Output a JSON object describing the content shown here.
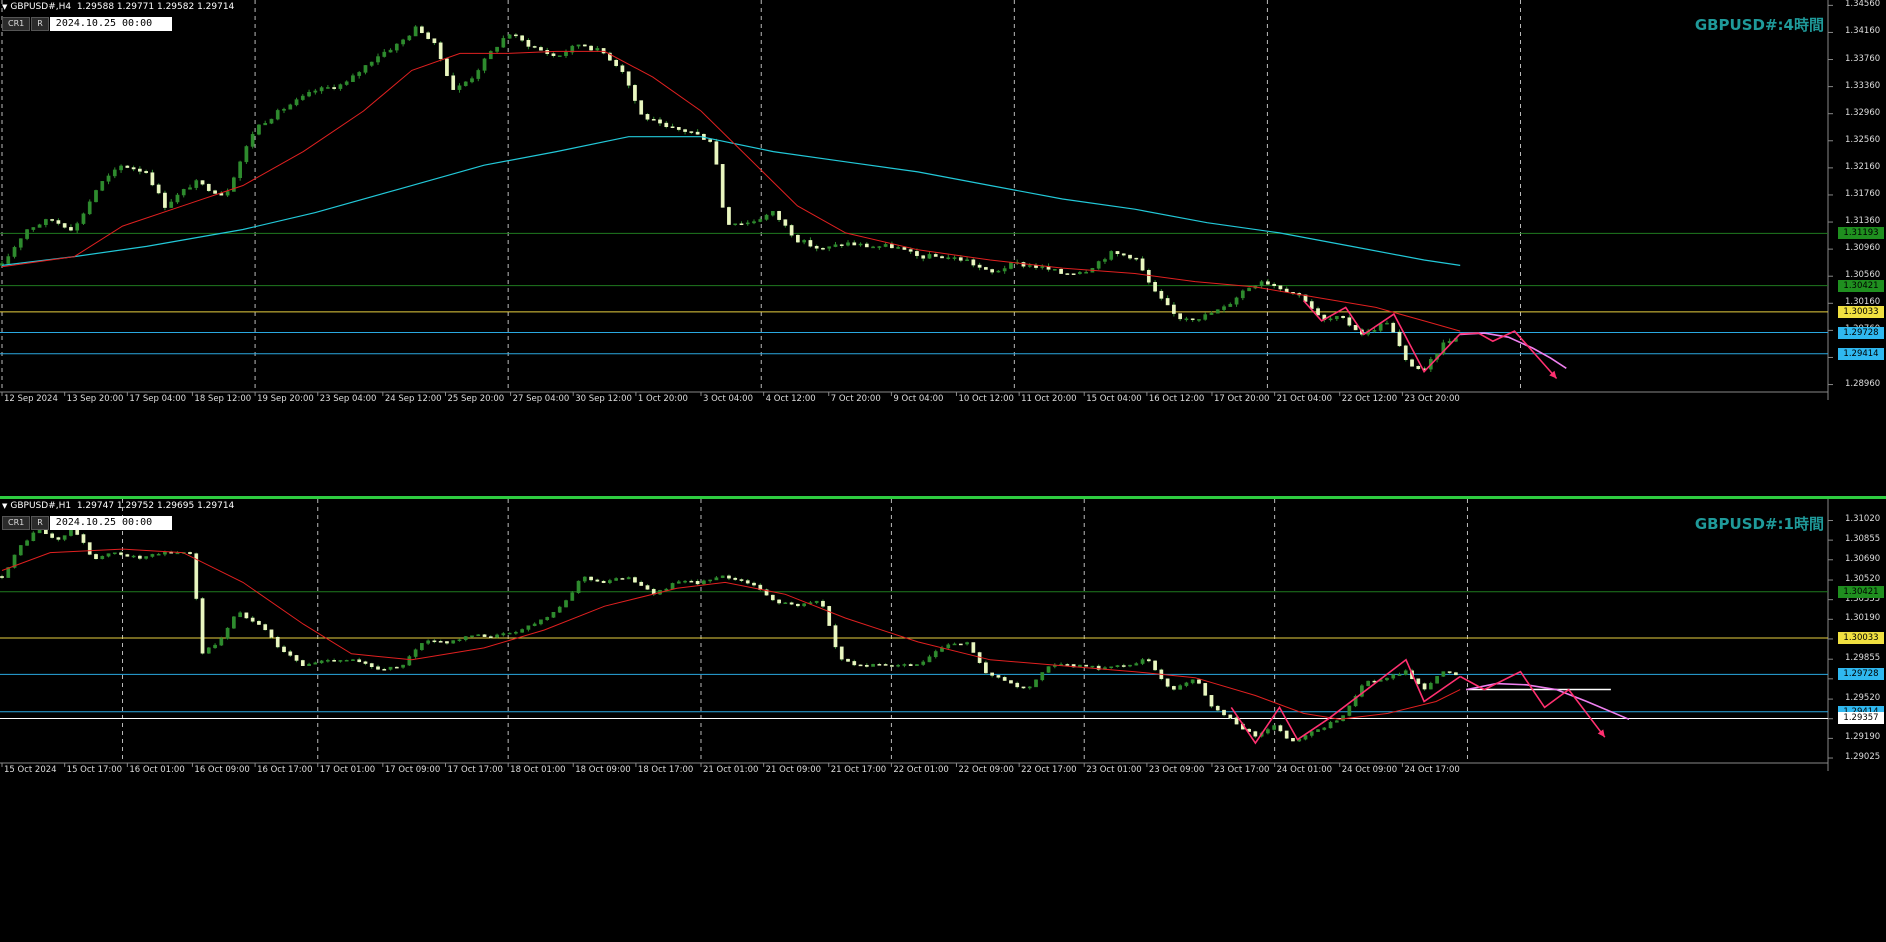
{
  "chart_data": [
    {
      "type": "candlestick",
      "symbol": "GBPUSD#,H4",
      "ohlc_header": "1.29588 1.29771 1.29582 1.29714",
      "title": "GBPUSD#:4時間",
      "toolbar": {
        "btn1": "CR1",
        "btn2": "R",
        "date": "2024.10.25 00:00"
      },
      "ylim": [
        1.2885,
        1.3458
      ],
      "y_ticks": [
        "1.34560",
        "1.34160",
        "1.33760",
        "1.33360",
        "1.32960",
        "1.32560",
        "1.32160",
        "1.31760",
        "1.31360",
        "1.30960",
        "1.30560",
        "1.30160",
        "1.29760",
        "1.29360",
        "1.28960"
      ],
      "x_ticks": [
        "12 Sep 2024",
        "13 Sep 20:00",
        "17 Sep 04:00",
        "18 Sep 12:00",
        "19 Sep 20:00",
        "23 Sep 04:00",
        "24 Sep 12:00",
        "25 Sep 20:00",
        "27 Sep 04:00",
        "30 Sep 12:00",
        "1 Oct 20:00",
        "3 Oct 04:00",
        "4 Oct 12:00",
        "7 Oct 20:00",
        "9 Oct 04:00",
        "10 Oct 12:00",
        "11 Oct 20:00",
        "15 Oct 04:00",
        "16 Oct 12:00",
        "17 Oct 20:00",
        "21 Oct 04:00",
        "22 Oct 12:00",
        "23 Oct 20:00"
      ],
      "x_tick_slot": [
        0,
        52,
        104,
        158,
        210,
        262,
        316,
        368,
        422,
        474,
        526,
        580,
        632,
        686,
        738,
        792,
        844,
        898,
        950,
        1004,
        1056,
        1110,
        1162
      ],
      "n_slots": 1243,
      "vgrid_slots": [
        0,
        210,
        420,
        630,
        840,
        1050,
        1260
      ],
      "price_labels": [
        {
          "value": 1.31193,
          "text": "1.31193",
          "color": "#1f8f1f"
        },
        {
          "value": 1.30421,
          "text": "1.30421",
          "color": "#1f8f1f"
        },
        {
          "value": 1.30033,
          "text": "1.30033",
          "color": "#f0e040"
        },
        {
          "value": 1.29728,
          "text": "1.29728",
          "color": "#2fb8f0"
        },
        {
          "value": 1.29414,
          "text": "1.29414",
          "color": "#2fb8f0"
        }
      ],
      "hlines": [
        {
          "value": 1.31193,
          "color": "#1f7a1f"
        },
        {
          "value": 1.30421,
          "color": "#1f7a1f"
        },
        {
          "value": 1.30033,
          "color": "#e8d040"
        },
        {
          "value": 1.29728,
          "color": "#2aa8e0"
        },
        {
          "value": 1.29414,
          "color": "#2aa8e0"
        }
      ],
      "close_path": [
        [
          0,
          1.3072
        ],
        [
          20,
          1.3125
        ],
        [
          40,
          1.314
        ],
        [
          60,
          1.3125
        ],
        [
          80,
          1.319
        ],
        [
          100,
          1.322
        ],
        [
          120,
          1.321
        ],
        [
          135,
          1.316
        ],
        [
          160,
          1.3195
        ],
        [
          185,
          1.3175
        ],
        [
          210,
          1.3275
        ],
        [
          235,
          1.3305
        ],
        [
          260,
          1.333
        ],
        [
          285,
          1.334
        ],
        [
          310,
          1.338
        ],
        [
          330,
          1.34
        ],
        [
          345,
          1.3425
        ],
        [
          360,
          1.3395
        ],
        [
          375,
          1.333
        ],
        [
          390,
          1.335
        ],
        [
          405,
          1.3385
        ],
        [
          420,
          1.3415
        ],
        [
          440,
          1.3395
        ],
        [
          460,
          1.338
        ],
        [
          480,
          1.34
        ],
        [
          500,
          1.3385
        ],
        [
          515,
          1.336
        ],
        [
          530,
          1.3295
        ],
        [
          550,
          1.3275
        ],
        [
          570,
          1.327
        ],
        [
          590,
          1.3255
        ],
        [
          600,
          1.3135
        ],
        [
          620,
          1.3135
        ],
        [
          640,
          1.315
        ],
        [
          660,
          1.311
        ],
        [
          680,
          1.3095
        ],
        [
          700,
          1.3105
        ],
        [
          720,
          1.31
        ],
        [
          740,
          1.31
        ],
        [
          760,
          1.3085
        ],
        [
          780,
          1.3085
        ],
        [
          800,
          1.308
        ],
        [
          820,
          1.306
        ],
        [
          840,
          1.3075
        ],
        [
          860,
          1.307
        ],
        [
          880,
          1.306
        ],
        [
          900,
          1.3065
        ],
        [
          920,
          1.309
        ],
        [
          940,
          1.3085
        ],
        [
          955,
          1.3035
        ],
        [
          975,
          1.2995
        ],
        [
          995,
          1.2995
        ],
        [
          1015,
          1.301
        ],
        [
          1030,
          1.3035
        ],
        [
          1045,
          1.305
        ],
        [
          1060,
          1.304
        ],
        [
          1080,
          1.3025
        ],
        [
          1095,
          1.299
        ],
        [
          1110,
          1.2995
        ],
        [
          1130,
          1.297
        ],
        [
          1150,
          1.299
        ],
        [
          1165,
          1.293
        ],
        [
          1180,
          1.2915
        ],
        [
          1195,
          1.2955
        ],
        [
          1210,
          1.2971
        ]
      ],
      "ma_red": [
        [
          0,
          1.307
        ],
        [
          60,
          1.3085
        ],
        [
          100,
          1.313
        ],
        [
          150,
          1.316
        ],
        [
          200,
          1.319
        ],
        [
          250,
          1.324
        ],
        [
          300,
          1.33
        ],
        [
          340,
          1.336
        ],
        [
          380,
          1.3385
        ],
        [
          420,
          1.3385
        ],
        [
          460,
          1.3388
        ],
        [
          500,
          1.3388
        ],
        [
          540,
          1.335
        ],
        [
          580,
          1.33
        ],
        [
          620,
          1.323
        ],
        [
          660,
          1.316
        ],
        [
          700,
          1.312
        ],
        [
          760,
          1.3095
        ],
        [
          820,
          1.308
        ],
        [
          880,
          1.3068
        ],
        [
          940,
          1.306
        ],
        [
          990,
          1.3048
        ],
        [
          1040,
          1.304
        ],
        [
          1090,
          1.3025
        ],
        [
          1140,
          1.301
        ],
        [
          1180,
          1.299
        ],
        [
          1210,
          1.2975
        ]
      ],
      "ma_cyan": [
        [
          0,
          1.3072
        ],
        [
          60,
          1.3085
        ],
        [
          120,
          1.31
        ],
        [
          200,
          1.3125
        ],
        [
          260,
          1.315
        ],
        [
          330,
          1.3185
        ],
        [
          400,
          1.322
        ],
        [
          460,
          1.324
        ],
        [
          520,
          1.3262
        ],
        [
          580,
          1.3262
        ],
        [
          640,
          1.324
        ],
        [
          700,
          1.3225
        ],
        [
          760,
          1.321
        ],
        [
          820,
          1.319
        ],
        [
          880,
          1.317
        ],
        [
          940,
          1.3155
        ],
        [
          1000,
          1.3135
        ],
        [
          1060,
          1.312
        ],
        [
          1120,
          1.31
        ],
        [
          1180,
          1.308
        ],
        [
          1210,
          1.3072
        ]
      ],
      "zigzag_past": [
        [
          1080,
          1.302
        ],
        [
          1095,
          1.299
        ],
        [
          1115,
          1.301
        ],
        [
          1130,
          1.297
        ],
        [
          1155,
          1.3
        ],
        [
          1180,
          1.2915
        ],
        [
          1210,
          1.2971
        ]
      ],
      "forecast_zigzag": [
        [
          1210,
          1.2971
        ],
        [
          1225,
          1.2972
        ],
        [
          1237,
          1.296
        ],
        [
          1255,
          1.2975
        ],
        [
          1275,
          1.2935
        ],
        [
          1290,
          1.2905
        ]
      ],
      "forecast_curve": [
        [
          1210,
          1.297
        ],
        [
          1230,
          1.2972
        ],
        [
          1250,
          1.2966
        ],
        [
          1270,
          1.295
        ],
        [
          1285,
          1.2935
        ],
        [
          1298,
          1.292
        ]
      ]
    },
    {
      "type": "candlestick",
      "symbol": "GBPUSD#,H1",
      "ohlc_header": "1.29747 1.29752 1.29695 1.29714",
      "title": "GBPUSD#:1時間",
      "toolbar": {
        "btn1": "CR1",
        "btn2": "R",
        "date": "2024.10.25 00:00"
      },
      "ylim": [
        1.29,
        1.3115
      ],
      "y_ticks": [
        "1.31020",
        "1.30855",
        "1.30690",
        "1.30520",
        "1.30355",
        "1.30190",
        "1.30025",
        "1.29855",
        "1.29690",
        "1.29520",
        "1.29355",
        "1.29190",
        "1.29025"
      ],
      "x_ticks": [
        "15 Oct 2024",
        "15 Oct 17:00",
        "16 Oct 01:00",
        "16 Oct 09:00",
        "16 Oct 17:00",
        "17 Oct 01:00",
        "17 Oct 09:00",
        "17 Oct 17:00",
        "18 Oct 01:00",
        "18 Oct 09:00",
        "18 Oct 17:00",
        "21 Oct 01:00",
        "21 Oct 09:00",
        "21 Oct 17:00",
        "22 Oct 01:00",
        "22 Oct 09:00",
        "22 Oct 17:00",
        "23 Oct 01:00",
        "23 Oct 09:00",
        "23 Oct 17:00",
        "24 Oct 01:00",
        "24 Oct 09:00",
        "24 Oct 17:00"
      ],
      "x_tick_slot": [
        0,
        52,
        104,
        158,
        210,
        262,
        316,
        368,
        420,
        474,
        526,
        580,
        632,
        686,
        738,
        792,
        844,
        898,
        950,
        1004,
        1056,
        1110,
        1162
      ],
      "n_slots": 1243,
      "vgrid_slots": [
        100,
        262,
        420,
        580,
        738,
        898,
        1056,
        1216
      ],
      "price_labels": [
        {
          "value": 1.30421,
          "text": "1.30421",
          "color": "#1f8f1f"
        },
        {
          "value": 1.30033,
          "text": "1.30033",
          "color": "#f0e040"
        },
        {
          "value": 1.29728,
          "text": "1.29728",
          "color": "#2fb8f0"
        },
        {
          "value": 1.29414,
          "text": "1.29414",
          "color": "#2fb8f0"
        },
        {
          "value": 1.29357,
          "text": "1.29357",
          "color": "#ffffff"
        }
      ],
      "hlines": [
        {
          "value": 1.30421,
          "color": "#1f7a1f"
        },
        {
          "value": 1.30033,
          "color": "#e8d040"
        },
        {
          "value": 1.29728,
          "color": "#2aa8e0"
        },
        {
          "value": 1.29414,
          "color": "#2aa8e0"
        },
        {
          "value": 1.29357,
          "color": "#ffffff"
        }
      ],
      "short_hline": {
        "value": 1.296,
        "x_from": 1215,
        "x_to": 1335,
        "color": "#ffffff"
      },
      "close_path": [
        [
          0,
          1.3055
        ],
        [
          15,
          1.308
        ],
        [
          30,
          1.3095
        ],
        [
          45,
          1.3085
        ],
        [
          60,
          1.3095
        ],
        [
          75,
          1.307
        ],
        [
          95,
          1.3075
        ],
        [
          115,
          1.307
        ],
        [
          135,
          1.3075
        ],
        [
          158,
          1.3075
        ],
        [
          165,
          1.299
        ],
        [
          180,
          1.3
        ],
        [
          195,
          1.3025
        ],
        [
          215,
          1.3015
        ],
        [
          230,
          1.2995
        ],
        [
          250,
          1.298
        ],
        [
          270,
          1.2985
        ],
        [
          290,
          1.2985
        ],
        [
          310,
          1.2978
        ],
        [
          330,
          1.2978
        ],
        [
          350,
          1.3
        ],
        [
          370,
          1.3
        ],
        [
          390,
          1.3005
        ],
        [
          410,
          1.3005
        ],
        [
          430,
          1.301
        ],
        [
          450,
          1.302
        ],
        [
          470,
          1.3035
        ],
        [
          480,
          1.3055
        ],
        [
          500,
          1.305
        ],
        [
          520,
          1.3055
        ],
        [
          540,
          1.304
        ],
        [
          560,
          1.305
        ],
        [
          580,
          1.305
        ],
        [
          600,
          1.3055
        ],
        [
          620,
          1.305
        ],
        [
          640,
          1.3035
        ],
        [
          660,
          1.303
        ],
        [
          680,
          1.3035
        ],
        [
          695,
          1.2985
        ],
        [
          715,
          1.298
        ],
        [
          740,
          1.298
        ],
        [
          760,
          1.298
        ],
        [
          780,
          1.2995
        ],
        [
          800,
          1.3
        ],
        [
          815,
          1.2975
        ],
        [
          835,
          1.2965
        ],
        [
          850,
          1.296
        ],
        [
          870,
          1.298
        ],
        [
          890,
          1.298
        ],
        [
          910,
          1.2978
        ],
        [
          930,
          1.298
        ],
        [
          950,
          1.2985
        ],
        [
          970,
          1.296
        ],
        [
          990,
          1.297
        ],
        [
          1005,
          1.2945
        ],
        [
          1020,
          1.2935
        ],
        [
          1040,
          1.292
        ],
        [
          1055,
          1.293
        ],
        [
          1070,
          1.2915
        ],
        [
          1090,
          1.2925
        ],
        [
          1110,
          1.2935
        ],
        [
          1130,
          1.2965
        ],
        [
          1150,
          1.297
        ],
        [
          1165,
          1.2975
        ],
        [
          1180,
          1.296
        ],
        [
          1195,
          1.2975
        ],
        [
          1210,
          1.2971
        ]
      ],
      "ma_red": [
        [
          0,
          1.306
        ],
        [
          40,
          1.3075
        ],
        [
          100,
          1.3078
        ],
        [
          150,
          1.3075
        ],
        [
          200,
          1.305
        ],
        [
          250,
          1.3015
        ],
        [
          290,
          1.299
        ],
        [
          340,
          1.2985
        ],
        [
          400,
          1.2995
        ],
        [
          450,
          1.301
        ],
        [
          500,
          1.303
        ],
        [
          560,
          1.3045
        ],
        [
          600,
          1.305
        ],
        [
          650,
          1.304
        ],
        [
          700,
          1.302
        ],
        [
          760,
          1.3
        ],
        [
          820,
          1.2985
        ],
        [
          880,
          1.298
        ],
        [
          940,
          1.2975
        ],
        [
          990,
          1.297
        ],
        [
          1040,
          1.2955
        ],
        [
          1080,
          1.294
        ],
        [
          1110,
          1.2935
        ],
        [
          1150,
          1.294
        ],
        [
          1190,
          1.295
        ],
        [
          1210,
          1.296
        ]
      ],
      "zigzag_past": [
        [
          1020,
          1.2945
        ],
        [
          1040,
          1.2915
        ],
        [
          1060,
          1.2945
        ],
        [
          1075,
          1.2918
        ],
        [
          1100,
          1.2935
        ],
        [
          1165,
          1.2985
        ],
        [
          1180,
          1.295
        ],
        [
          1210,
          1.2971
        ]
      ],
      "forecast_zigzag": [
        [
          1210,
          1.2971
        ],
        [
          1230,
          1.296
        ],
        [
          1260,
          1.2975
        ],
        [
          1280,
          1.2945
        ],
        [
          1300,
          1.296
        ],
        [
          1330,
          1.292
        ]
      ],
      "forecast_curve": [
        [
          1215,
          1.296
        ],
        [
          1240,
          1.2965
        ],
        [
          1265,
          1.2964
        ],
        [
          1290,
          1.296
        ],
        [
          1315,
          1.295
        ],
        [
          1350,
          1.2935
        ]
      ]
    }
  ]
}
